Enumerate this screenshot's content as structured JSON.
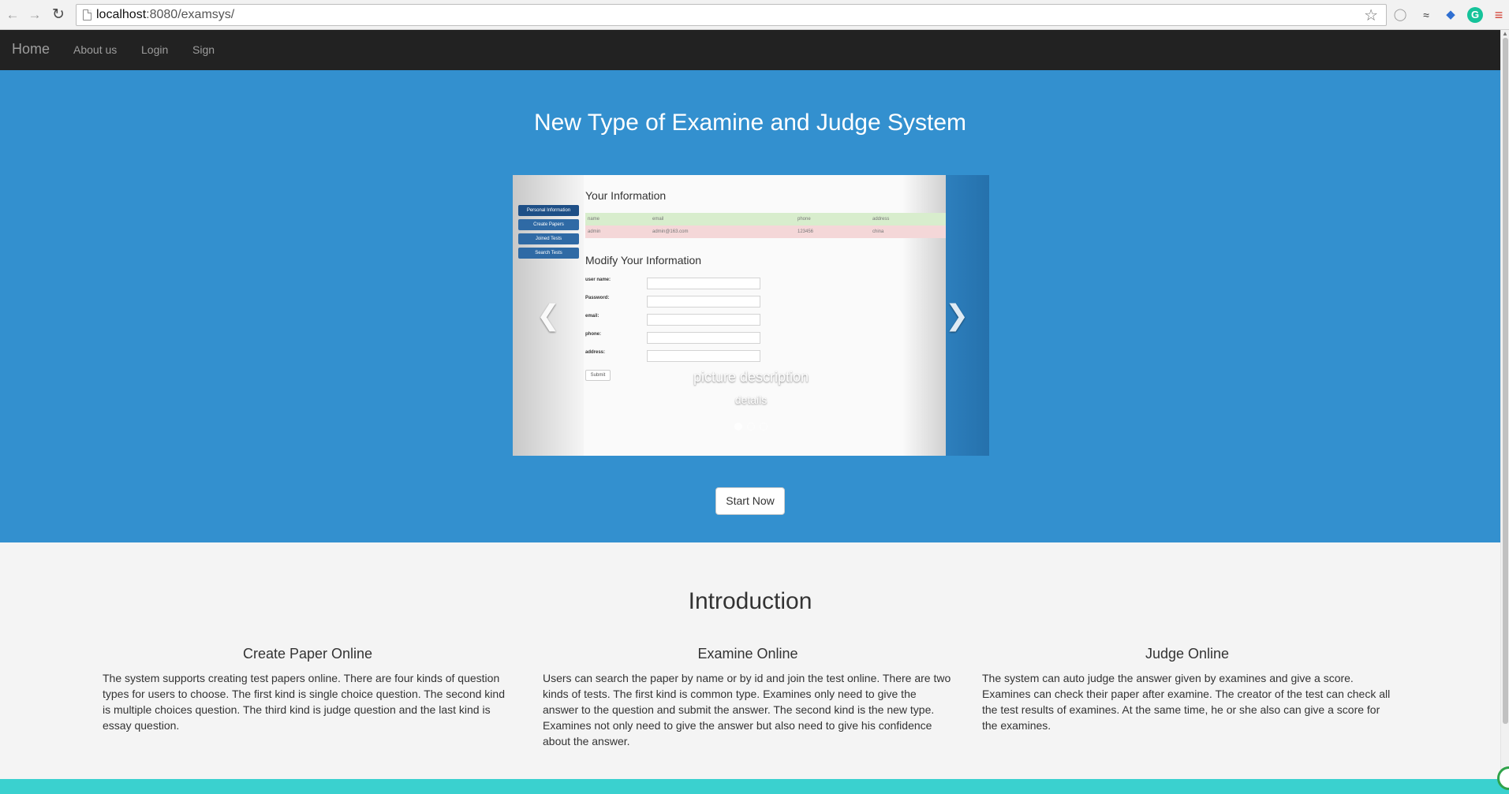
{
  "browser": {
    "url_host": "localhost",
    "url_rest": ":8080/examsys/",
    "icons": {
      "back": "back-arrow-icon",
      "forward": "forward-arrow-icon",
      "reload": "reload-icon",
      "bookmark": "star-icon"
    }
  },
  "navbar": {
    "brand": "Home",
    "links": [
      "About us",
      "Login",
      "Sign"
    ]
  },
  "hero": {
    "title": "New Type of Examine and Judge System",
    "carousel": {
      "slide": {
        "sidebar": [
          "Personal Information",
          "Create Papers",
          "Joined Tests",
          "Search Tests"
        ],
        "info_title": "Your Information",
        "table_headers": [
          "name",
          "email",
          "phone",
          "address"
        ],
        "table_row": [
          "admin",
          "admin@163.com",
          "123456",
          "china"
        ],
        "modify_title": "Modify Your Information",
        "fields": [
          "user name:",
          "Password:",
          "email:",
          "phone:",
          "address:"
        ],
        "submit": "Submit"
      },
      "caption_title": "picture description",
      "caption_text": "details",
      "indicator_count": 3,
      "active_indicator": 0,
      "prev_icon": "chevron-left-icon",
      "next_icon": "chevron-right-icon"
    },
    "start_button": "Start Now"
  },
  "intro": {
    "title": "Introduction",
    "columns": [
      {
        "heading": "Create Paper Online",
        "text": "The system supports creating test papers online. There are four kinds of question types for users to choose. The first kind is single choice question. The second kind is multiple choices question. The third kind is judge question and the last kind is essay question."
      },
      {
        "heading": "Examine Online",
        "text": "Users can search the paper by name or by id and join the test online. There are two kinds of tests. The first kind is common type. Examines only need to give the answer to the question and submit the answer. The second kind is the new type. Examines not only need to give the answer but also need to give his confidence about the answer."
      },
      {
        "heading": "Judge Online",
        "text": "The system can auto judge the answer given by examines and give a score. Examines can check their paper after examine. The creator of the test can check all the test results of examines. At the same time, he or she also can give a score for the examines."
      }
    ]
  },
  "colors": {
    "navbar": "#222222",
    "hero": "#3390cf",
    "footer_strip": "#3ad1cf"
  }
}
